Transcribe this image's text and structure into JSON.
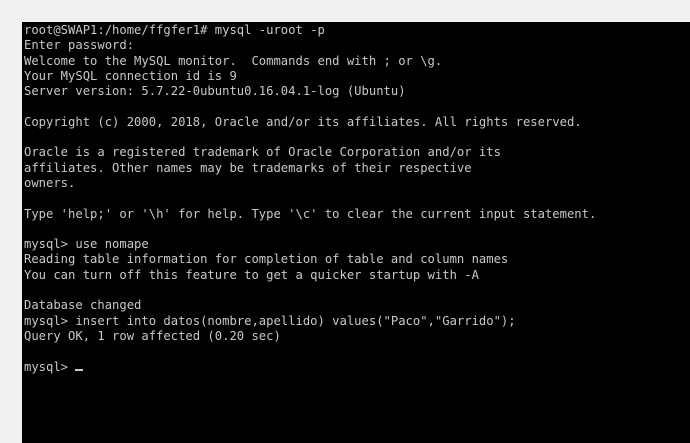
{
  "terminal": {
    "lines": [
      "root@SWAP1:/home/ffgfer1# mysql -uroot -p",
      "Enter password:",
      "Welcome to the MySQL monitor.  Commands end with ; or \\g.",
      "Your MySQL connection id is 9",
      "Server version: 5.7.22-0ubuntu0.16.04.1-log (Ubuntu)",
      "",
      "Copyright (c) 2000, 2018, Oracle and/or its affiliates. All rights reserved.",
      "",
      "Oracle is a registered trademark of Oracle Corporation and/or its",
      "affiliates. Other names may be trademarks of their respective",
      "owners.",
      "",
      "Type 'help;' or '\\h' for help. Type '\\c' to clear the current input statement.",
      "",
      "mysql> use nomape",
      "Reading table information for completion of table and column names",
      "You can turn off this feature to get a quicker startup with -A",
      "",
      "Database changed",
      "mysql> insert into datos(nombre,apellido) values(\"Paco\",\"Garrido\");",
      "Query OK, 1 row affected (0.20 sec)",
      "",
      "mysql> "
    ],
    "text_color": "#c8c8c8",
    "background_color": "#000000"
  }
}
